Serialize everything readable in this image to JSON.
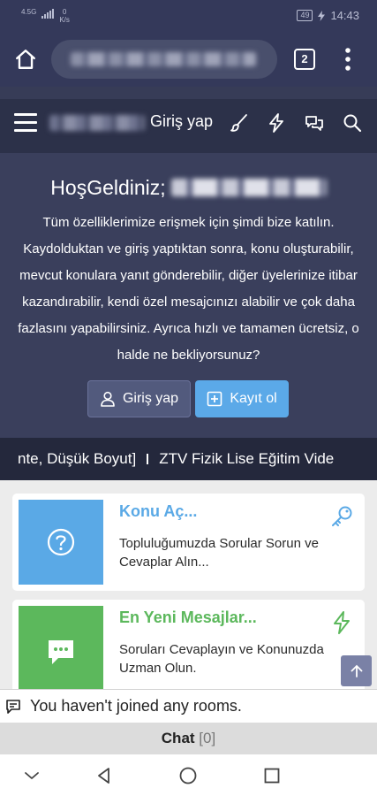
{
  "status_bar": {
    "network": "4.5G",
    "speed_value": "0",
    "speed_unit": "K/s",
    "battery": "49",
    "time": "14:43"
  },
  "browser": {
    "url": "••••••••••••••••",
    "tab_count": "2"
  },
  "header": {
    "login_label": "Giriş yap"
  },
  "welcome": {
    "title": "HoşGeldiniz;",
    "text": "Tüm özelliklerimize erişmek için şimdi bize katılın. Kaydolduktan ve giriş yaptıktan sonra, konu oluşturabilir, mevcut konulara yanıt gönderebilir, diğer üyelerinize itibar kazandırabilir, kendi özel mesajcınızı alabilir ve çok daha fazlasını yapabilirsiniz. Ayrıca hızlı ve tamamen ücretsiz, o halde ne bekliyorsunuz?",
    "login_button": "Giriş yap",
    "register_button": "Kayıt ol"
  },
  "ticker": {
    "item_left": "nte, Düşük Boyut]",
    "item_right": "ZTV Fizik Lise Eğitim Vide"
  },
  "cards": [
    {
      "title": "Konu Aç...",
      "description": "Topluluğumuzda Sorular Sorun ve Cevaplar Alın...",
      "color": "#5aa9e6"
    },
    {
      "title": "En Yeni Mesajlar...",
      "description": "Soruları Cevaplayın ve Konunuzda Uzman Olun.",
      "color": "#5cb85c"
    }
  ],
  "chat": {
    "rooms_text": "You haven't joined any rooms.",
    "label": "Chat",
    "count": "[0]"
  },
  "colors": {
    "nav_dark": "#34395a",
    "panel": "#3a3f5c",
    "accent_blue": "#5ba9e8",
    "accent_green": "#5cb85c"
  }
}
